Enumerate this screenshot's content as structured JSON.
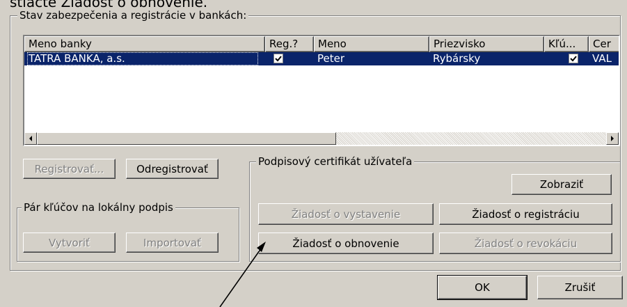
{
  "caption_top": "stlačte Žiadosť o obnovenie.",
  "status_group": {
    "label": "Stav zabezpečenia a registrácie v bankách:"
  },
  "bank_list": {
    "columns": [
      "Meno banky",
      "Reg.?",
      "Meno",
      "Priezvisko",
      "Kľú...",
      "Cer"
    ],
    "rows": [
      {
        "bank": "TATRA BANKA, a.s.",
        "reg": true,
        "first_name": "Peter",
        "last_name": "Rybársky",
        "key": true,
        "cert": "VAL"
      }
    ],
    "selected_row": 0
  },
  "buttons": {
    "register": "Registrovať...",
    "unregister": "Odregistrovať",
    "create": "Vytvoriť",
    "import": "Importovať",
    "show": "Zobraziť",
    "request_issue": "Žiadosť o vystavenie",
    "request_registration": "Žiadosť o registráciu",
    "request_renewal": "Žiadosť o obnovenie",
    "request_revocation": "Žiadosť o revokáciu",
    "ok": "OK",
    "cancel": "Zrušiť"
  },
  "keypair_group": {
    "label": "Pár kľúčov na lokálny podpis"
  },
  "cert_group": {
    "label": "Podpisový certifikát užívateľa"
  },
  "colors": {
    "dialog_bg": "#d4d0c8",
    "selection": "#0a246a",
    "selection_text": "#ffffff",
    "disabled_text": "#808080"
  },
  "icons": [
    "checkbox-checked-icon",
    "scroll-left-arrow-icon",
    "scroll-right-arrow-icon",
    "annotation-arrow"
  ]
}
